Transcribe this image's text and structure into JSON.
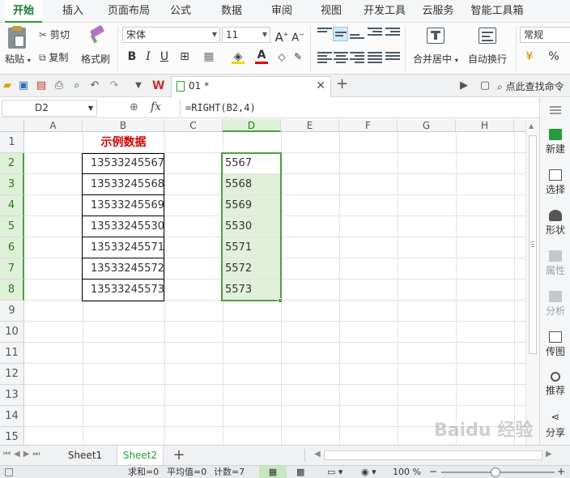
{
  "menu": {
    "tabs": [
      "开始",
      "插入",
      "页面布局",
      "公式",
      "数据",
      "审阅",
      "视图",
      "开发工具",
      "云服务",
      "智能工具箱"
    ]
  },
  "ribbon": {
    "paste": "粘贴",
    "cut": "剪切",
    "copy": "复制",
    "format_painter": "格式刷",
    "font_name": "宋体",
    "font_size": "11",
    "merge_center": "合并居中",
    "wrap_text": "自动换行",
    "number_format": "常规",
    "percent": "%",
    "bold": "B",
    "italic": "I",
    "underline": "U",
    "grow_font": "A",
    "shrink_font": "A",
    "fill_glyph": "◈",
    "font_color": "A"
  },
  "quickbar": {
    "doc_tab": "01 *",
    "search": "点此查找命令"
  },
  "formula_bar": {
    "cell_ref": "D2",
    "fx": "fx",
    "formula": "=RIGHT(B2,4)"
  },
  "columns": [
    "A",
    "B",
    "C",
    "D",
    "E",
    "F",
    "G",
    "H"
  ],
  "rows": [
    "1",
    "2",
    "3",
    "4",
    "5",
    "6",
    "7",
    "8",
    "9",
    "10",
    "11",
    "12",
    "13",
    "14",
    "15"
  ],
  "cells": {
    "B1": "示例数据",
    "B": [
      "13533245567",
      "13533245568",
      "13533245569",
      "13533245530",
      "13533245571",
      "13533245572",
      "13533245573"
    ],
    "D": [
      "5567",
      "5568",
      "5569",
      "5530",
      "5571",
      "5572",
      "5573"
    ]
  },
  "sidepane": {
    "items": [
      "新建",
      "选择",
      "形状",
      "属性",
      "分析",
      "传图",
      "推荐",
      "分享"
    ]
  },
  "sheets": {
    "tabs": [
      "Sheet1",
      "Sheet2"
    ],
    "add": "+"
  },
  "status": {
    "sum": "求和=0",
    "avg": "平均值=0",
    "count": "计数=7",
    "zoom": "100 %",
    "zoom_minus": "−",
    "zoom_plus": "+"
  },
  "colors": {
    "accent": "#2b9a3b",
    "selection": "#4e9d45",
    "highlight": "#e2f0d9",
    "header_red": "#d40000"
  },
  "watermark": "Baidu 经验"
}
